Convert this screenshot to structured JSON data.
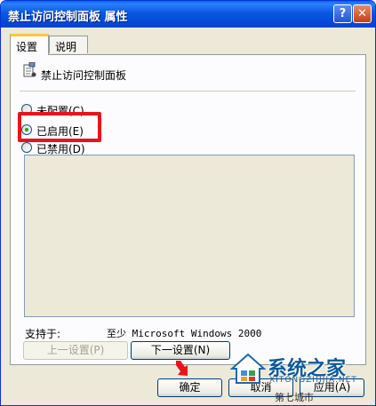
{
  "window": {
    "title": "禁止访问控制面板 属性",
    "help_glyph": "?",
    "close_glyph": "✕"
  },
  "tabs": [
    {
      "label": "设置",
      "active": true
    },
    {
      "label": "说明",
      "active": false
    }
  ],
  "policy": {
    "name": "禁止访问控制面板",
    "icon": "policy-document-icon"
  },
  "radios": {
    "unconfigured": {
      "label": "未配置(C)",
      "checked": false
    },
    "enabled": {
      "label": "已启用(E)",
      "checked": true
    },
    "disabled": {
      "label": "已禁用(D)",
      "checked": false
    }
  },
  "support": {
    "label": "支持于:",
    "value": "至少 Microsoft Windows 2000"
  },
  "nav_buttons": {
    "prev": "上一设置(P)",
    "next": "下一设置(N)"
  },
  "dialog_buttons": {
    "ok": "确定",
    "cancel": "取消",
    "apply": "应用(A)"
  },
  "watermark": {
    "main": "系统之家",
    "sub": "XITONGZHIJIA.NET",
    "bottom": "第七城市"
  },
  "colors": {
    "highlight": "#e8141a",
    "titlebar": "#0b58e0",
    "watermark": "#0d5a9a"
  }
}
